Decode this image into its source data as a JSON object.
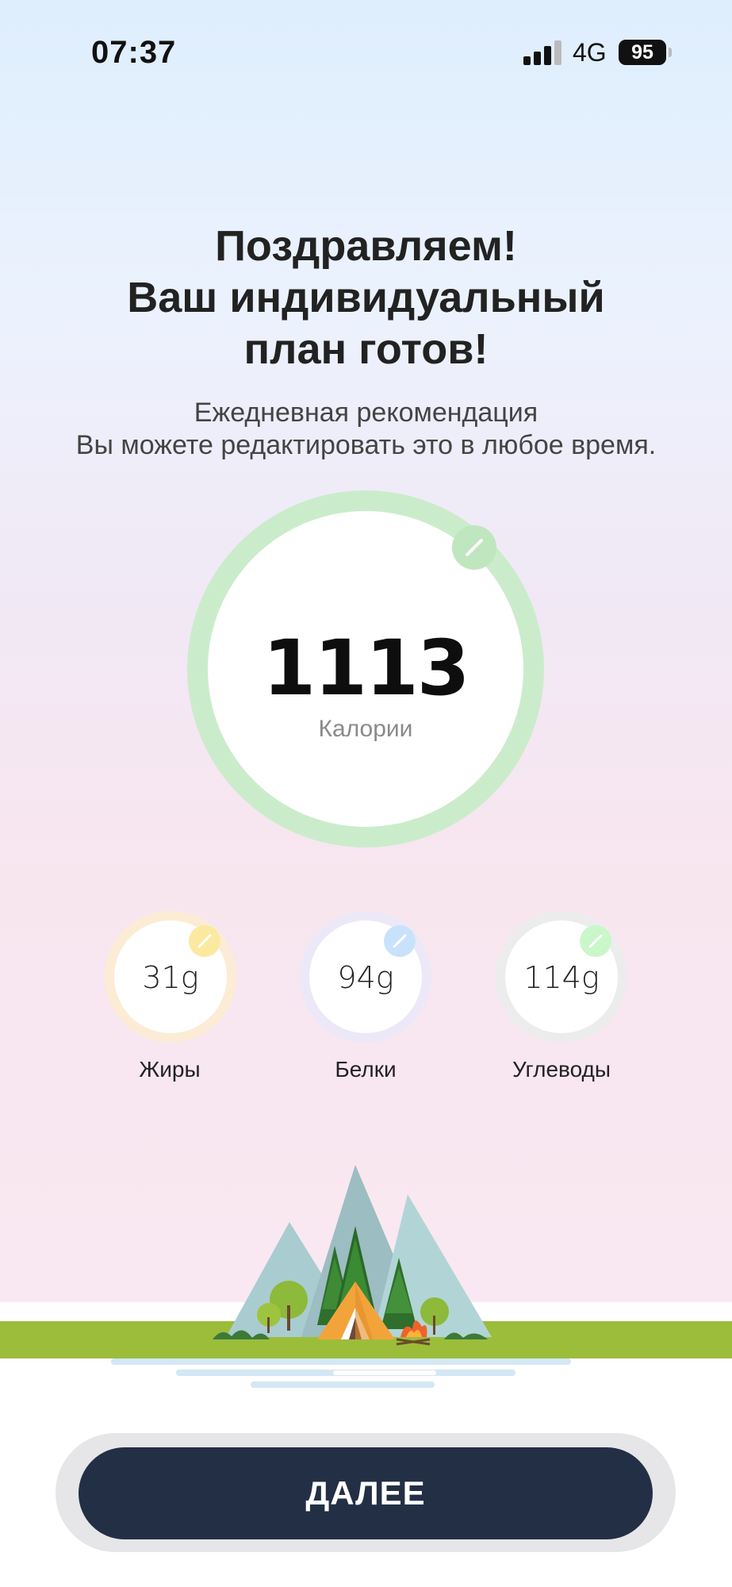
{
  "status_bar": {
    "time": "07:37",
    "network": "4G",
    "battery": "95"
  },
  "header": {
    "title_lines": [
      "Поздравляем!",
      "Ваш индивидуальный",
      "план готов!"
    ],
    "subtitle_lines": [
      "Ежедневная рекомендация",
      "Вы можете редактировать это в любое время."
    ]
  },
  "calories": {
    "value": "1113",
    "label": "Калории",
    "ring_color": "#cbeccb"
  },
  "macros": [
    {
      "value": "31g",
      "label": "Жиры",
      "ring_color": "#fcecd6",
      "badge_color": "#fbe9a0"
    },
    {
      "value": "94g",
      "label": "Белки",
      "ring_color": "#ece8f7",
      "badge_color": "#c9e2fb"
    },
    {
      "value": "114g",
      "label": "Углеводы",
      "ring_color": "#ececec",
      "badge_color": "#c9f7c9"
    }
  ],
  "icons": {
    "edit": "pencil-icon",
    "signal": "signal-bars-icon",
    "battery": "battery-icon",
    "illustration": "camping-tent-illustration"
  },
  "cta": {
    "label": "ДАЛЕЕ"
  },
  "colors": {
    "accent_button": "#232f44",
    "grass": "#9bbd3a"
  }
}
